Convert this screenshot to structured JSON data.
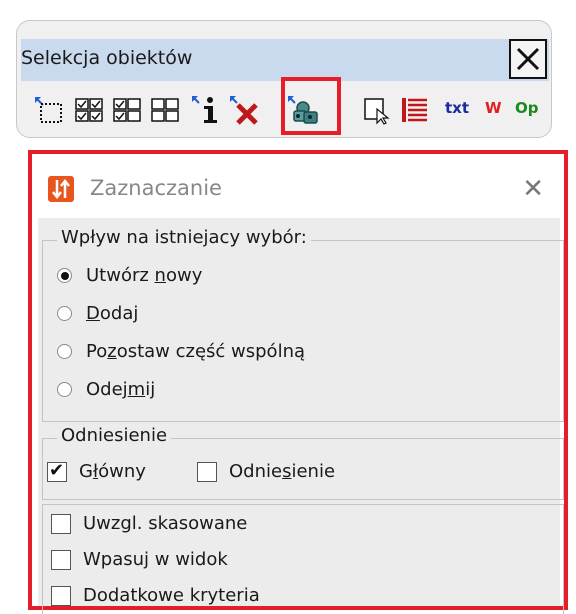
{
  "toolbar_window": {
    "title": "Selekcja obiektów",
    "buttons": [
      {
        "name": "select-rect-icon"
      },
      {
        "name": "select-all-icon"
      },
      {
        "name": "select-partial-icon"
      },
      {
        "name": "select-none-icon"
      },
      {
        "name": "info-icon"
      },
      {
        "name": "delete-icon"
      },
      {
        "name": "selection-settings-icon"
      },
      {
        "name": "select-region-icon"
      },
      {
        "name": "list-icon"
      },
      {
        "name": "txt-button",
        "label": "txt",
        "color": "#1a2d9c"
      },
      {
        "name": "w-button",
        "label": "W",
        "color": "#e02020"
      },
      {
        "name": "op-button",
        "label": "Op",
        "color": "#1a8a1a"
      }
    ]
  },
  "dialog": {
    "title": "Zaznaczanie",
    "group_existing": {
      "label": "Wpływ na istniejacy wybór:",
      "options": [
        {
          "pre": "Utwórz ",
          "ul": "n",
          "post": "owy",
          "selected": true
        },
        {
          "pre": "",
          "ul": "D",
          "post": "odaj",
          "selected": false
        },
        {
          "pre": "Po",
          "ul": "z",
          "post": "ostaw część wspólną",
          "selected": false
        },
        {
          "pre": "Odej",
          "ul": "m",
          "post": "ij",
          "selected": false
        }
      ]
    },
    "group_reference": {
      "label": "Odniesienie",
      "glowny": {
        "pre": "G",
        "ul": "ł",
        "post": "ówny",
        "checked": true
      },
      "odniesienie": {
        "pre": "Odnie",
        "ul": "s",
        "post": "ienie",
        "checked": false
      }
    },
    "extra_options": [
      {
        "label": "Uwzgl. skasowane",
        "checked": false
      },
      {
        "label": "Wpasuj w widok",
        "checked": false
      },
      {
        "label": "Dodatkowe kryteria",
        "checked": false
      }
    ]
  },
  "colors": {
    "highlight": "#e61e2a",
    "title_bar": "#c9d9ee",
    "app_icon": "#e8551d"
  }
}
